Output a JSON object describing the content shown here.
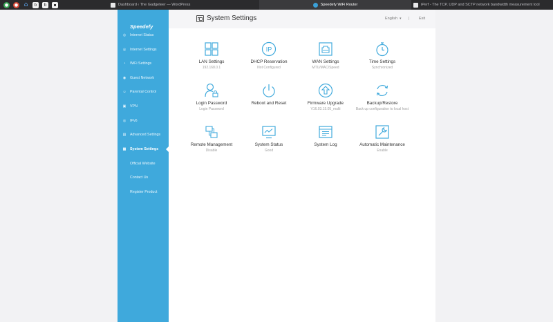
{
  "browser": {
    "tabs": [
      {
        "title": "Dashboard ‹ The Gadgeteer — WordPress",
        "active": false
      },
      {
        "title": "Speedefy WiFi Router",
        "active": true
      },
      {
        "title": "iPerf - The TCP, UDP and SCTP network bandwidth measurement tool",
        "active": false
      }
    ]
  },
  "brand": "Speedefy",
  "sidebar": {
    "items": [
      {
        "label": "Internet Status",
        "icon": "globe-icon"
      },
      {
        "label": "Internet Settings",
        "icon": "globe-settings-icon"
      },
      {
        "label": "WiFi Settings",
        "icon": "wifi-icon"
      },
      {
        "label": "Guest Network",
        "icon": "guest-icon"
      },
      {
        "label": "Parental Control",
        "icon": "parental-icon"
      },
      {
        "label": "VPN",
        "icon": "vpn-icon"
      },
      {
        "label": "IPv6",
        "icon": "ipv6-icon"
      },
      {
        "label": "Advanced Settings",
        "icon": "advanced-icon"
      },
      {
        "label": "System Settings",
        "icon": "system-icon",
        "active": true
      },
      {
        "label": "Official Website"
      },
      {
        "label": "Contact Us"
      },
      {
        "label": "Register Product"
      }
    ]
  },
  "header": {
    "title": "System Settings",
    "language": "English",
    "separator": "|",
    "exit": "Exit"
  },
  "tiles": [
    {
      "label": "LAN Settings",
      "sub": "192.168.0.1",
      "icon": "lan-icon"
    },
    {
      "label": "DHCP Reservation",
      "sub": "Not Configured",
      "icon": "ip-icon"
    },
    {
      "label": "WAN Settings",
      "sub": "MTU/MAC/Speed",
      "icon": "ethernet-port-icon"
    },
    {
      "label": "Time Settings",
      "sub": "Synchronized",
      "icon": "stopwatch-icon"
    },
    {
      "label": "Login Password",
      "sub": "Login Password",
      "icon": "user-lock-icon"
    },
    {
      "label": "Reboot and Reset",
      "sub": "",
      "icon": "power-icon"
    },
    {
      "label": "Firmware Upgrade",
      "sub": "V16.03.15.05_multi",
      "icon": "upgrade-icon"
    },
    {
      "label": "Backup/Restore",
      "sub": "Back up configuration to local host",
      "icon": "refresh-icon"
    },
    {
      "label": "Remote Management",
      "sub": "Disable",
      "icon": "remote-icon"
    },
    {
      "label": "System Status",
      "sub": "Good",
      "icon": "monitor-icon"
    },
    {
      "label": "System Log",
      "sub": "",
      "icon": "log-icon"
    },
    {
      "label": "Automatic Maintenance",
      "sub": "Enable",
      "icon": "wrench-icon"
    }
  ],
  "colors": {
    "accent": "#3fa9dc",
    "icon_blue": "#3fa9dc"
  }
}
